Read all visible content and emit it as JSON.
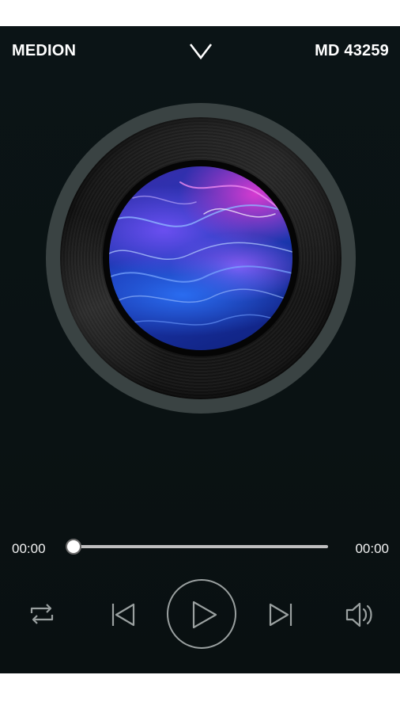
{
  "header": {
    "brand": "MEDION",
    "model": "MD 43259",
    "collapse_icon": "chevron-down-icon"
  },
  "player": {
    "artwork": "album-artwork-blue-purple-waves",
    "time_current": "00:00",
    "time_total": "00:00",
    "progress": 0
  },
  "controls": {
    "repeat_icon": "repeat-icon",
    "previous_icon": "skip-previous-icon",
    "play_icon": "play-icon",
    "next_icon": "skip-next-icon",
    "volume_icon": "volume-icon"
  },
  "colors": {
    "background": "#0a1213",
    "disc_rim": "#3a4343",
    "icon": "#9aa0a0",
    "text": "#ffffff"
  }
}
